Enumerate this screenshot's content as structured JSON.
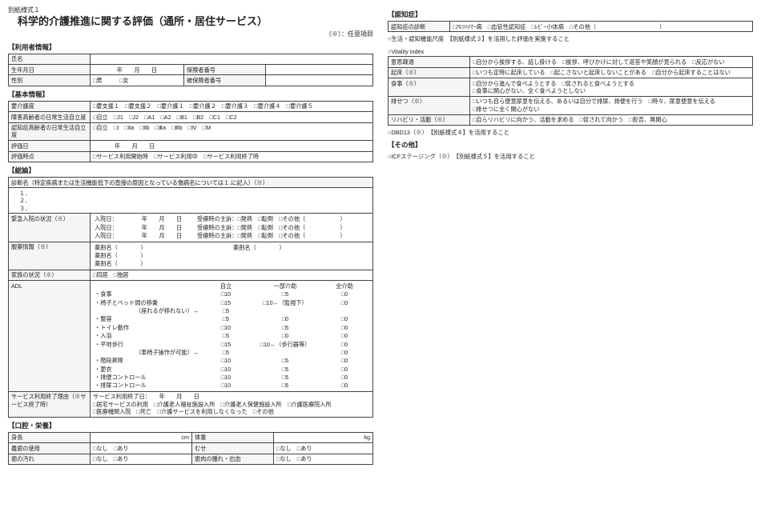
{
  "formNumber": "別紙様式１",
  "title": "科学的介護推進に関する評価（通所・居住サービス）",
  "optNote": "（※）：任意項目",
  "sec": {
    "user": "【利用者情報】",
    "basic": "【基本情報】",
    "sum": "【総論】",
    "oral": "【口腔・栄養】",
    "dem": "【認知症】",
    "other": "【その他】"
  },
  "user": {
    "name": "氏名",
    "dob": "生年月日",
    "dobfmt": "年　　月　　日",
    "insno": "保険者番号",
    "sex": "性別",
    "male": "□男",
    "female": "□女",
    "insured": "被保険者番号"
  },
  "basic": {
    "care": "要介護度",
    "carelv": "□要支援１　□要支援２　□要介護１　□要介護２　□要介護３　□要介護４　□要介護５",
    "disab": "障害高齢者の日常生活自立度",
    "disablv": "□自立　□J1　□J2　□A1　□A2　□B1　□B2　□C1　□C2",
    "cog": "認知症高齢者の日常生活自立度",
    "coglv": "□自立　□Ⅰ　□Ⅱa　□Ⅱb　□Ⅲa　□Ⅲb　□Ⅳ　□M",
    "evd": "評価日",
    "evdfmt": "年　　月　　日",
    "evp": "評価時点",
    "evplv": "□サービス利用開始時　□サービス利用中　□サービス利用終了時"
  },
  "sum": {
    "diag": "診断名（特定疾病または生活機能低下の直接の原因となっている傷病名については１.に記入）（※）",
    "n1": "１．",
    "n2": "２．",
    "n3": "３．",
    "hosp": "緊急入院の状況（※）",
    "adm": "入院日：",
    "ymd": "年　　月　　日",
    "chief": "受療時の主訴：□発熱　□転倒　□その他（　　　　　　）",
    "med": "服薬情報（※）",
    "med1": "薬剤名（　　　　）",
    "med2": "薬剤名（　　　　）",
    "med3": "薬剤名（　　　　）",
    "fam": "家族の状況（※）",
    "famopt": "□同居　□独居",
    "adl": "ADL",
    "adlhdr": {
      "a": "自立",
      "b": "一部介助",
      "c": "全介助"
    },
    "adlr": {
      "eat": "・食事",
      "chair": "・椅子とベッド間の移乗",
      "chairnote": "（座れるが移れない）→",
      "groom": "・整容",
      "toil": "・トイレ動作",
      "bath": "・入浴",
      "walk": "・平地歩行",
      "walknote": "（車椅子操作が可能）→",
      "stair": "・階段昇降",
      "dress": "・更衣",
      "bowel": "・排便コントロール",
      "urine": "・排尿コントロール"
    },
    "adlv": {
      "c10": "□10",
      "c5": "□5",
      "c0": "□0",
      "c15": "□15",
      "sup": "□10←（監視下）",
      "walk10": "□10←（歩行器等）"
    },
    "end": "サービス利用終了理由（※サービス終了時）",
    "enddate": "サービス利用終了日：　　年　　月　　日",
    "endopt": "□居宅サービスの利用　□介護老人福祉施設入所　□介護老人保健施設入所　□介護医療院入所\n□医療機関入院　□死亡　□介護サービスを利用しなくなった　□その他"
  },
  "oral": {
    "height": "身長",
    "cm": "cm",
    "weight": "体重",
    "kg": "kg",
    "dent": "義歯の使用",
    "yn": "□なし　□あり",
    "choke": "むせ",
    "stain": "歯の汚れ",
    "gum": "歯肉の腫れ・出血"
  },
  "dem": {
    "diag": "認知症の診断",
    "diagopt": "□ｱﾙﾂﾊｲﾏｰ病　□血管性認知症　□ﾚﾋﾞｰ小体病　□その他（　　　　　　　　　　　）",
    "scale": "○生活・認知機能尺度　【別紙様式３】を活用した評価を実施すること",
    "vi": "○Vitality index",
    "vir": {
      "will": "意思疎通",
      "willopt": "□自分から挨拶する、話し掛ける　□挨拶、呼びかけに対して返答や笑顔が見られる　□反応がない",
      "wake": "起床（※）",
      "wakeopt": "□いつも定時に起床している　□起こさないと起床しないことがある　□自分から起床することはない",
      "eat": "食事（※）",
      "eatopt": "□自分から進んで食べようとする　□促されると食べようとする\n□食事に関心がない、全く食べようとしない",
      "toil": "排せつ（※）",
      "toilopt": "□いつも自ら便意尿意を伝える、あるいは自分で排尿、排便を行う　□時々、尿意便意を伝える\n□排せつに全く関心がない",
      "rehab": "リハビリ・活動（※）",
      "rehabopt": "□自らリハビリに向かう、活動を求める　□促されて向かう　□拒否、無関心"
    },
    "dbd": "○DBD13（※）　【別紙様式４】を活用すること"
  },
  "other": {
    "icf": "○ICFステージング（※）　【別紙様式５】を活用すること"
  }
}
